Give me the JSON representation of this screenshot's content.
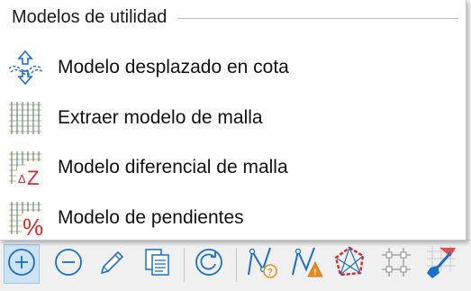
{
  "menu": {
    "title": "Modelos de utilidad",
    "items": [
      {
        "label": "Modelo desplazado en cota",
        "icon": "vertical-offset-icon"
      },
      {
        "label": "Extraer modelo de malla",
        "icon": "grid-icon"
      },
      {
        "label": "Modelo diferencial de malla",
        "icon": "grid-delta-z-icon"
      },
      {
        "label": "Modelo de pendientes",
        "icon": "grid-percent-icon"
      }
    ]
  },
  "toolbar": {
    "buttons": [
      {
        "icon": "zoom-in-icon"
      },
      {
        "icon": "zoom-out-icon"
      },
      {
        "icon": "pencil-icon"
      },
      {
        "icon": "document-copy-icon"
      },
      {
        "icon": "refresh-icon"
      },
      {
        "icon": "polyline-question-icon"
      },
      {
        "icon": "polyline-warning-icon"
      },
      {
        "icon": "triangulation-icon"
      },
      {
        "icon": "grid-points-icon"
      },
      {
        "icon": "excavation-icon"
      }
    ]
  },
  "colors": {
    "accent_blue": "#1a6fc6",
    "grid_yellow": "#d8c65a",
    "grid_blue": "#5a84b8",
    "red": "#e0262b",
    "orange": "#f08a1e"
  }
}
